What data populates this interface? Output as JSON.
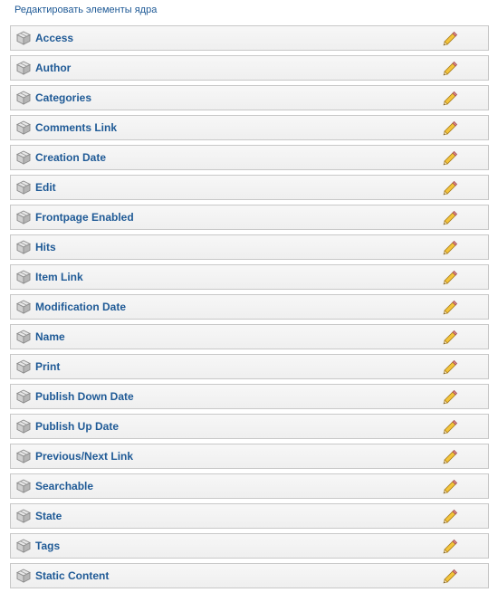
{
  "header": {
    "title": "Редактировать элементы ядра"
  },
  "items": [
    {
      "label": "Access"
    },
    {
      "label": "Author"
    },
    {
      "label": "Categories"
    },
    {
      "label": "Comments Link"
    },
    {
      "label": "Creation Date"
    },
    {
      "label": "Edit"
    },
    {
      "label": "Frontpage Enabled"
    },
    {
      "label": "Hits"
    },
    {
      "label": "Item Link"
    },
    {
      "label": "Modification Date"
    },
    {
      "label": "Name"
    },
    {
      "label": "Print"
    },
    {
      "label": "Publish Down Date"
    },
    {
      "label": "Publish Up Date"
    },
    {
      "label": "Previous/Next Link"
    },
    {
      "label": "Searchable"
    },
    {
      "label": "State"
    },
    {
      "label": "Tags"
    },
    {
      "label": "Static Content"
    }
  ],
  "icons": {
    "row_icon": "package-box-icon",
    "edit_icon": "pencil-edit-icon"
  },
  "colors": {
    "link": "#1f5a96",
    "row_bg": "#f2f2f2",
    "row_border": "#c8c8c8"
  }
}
